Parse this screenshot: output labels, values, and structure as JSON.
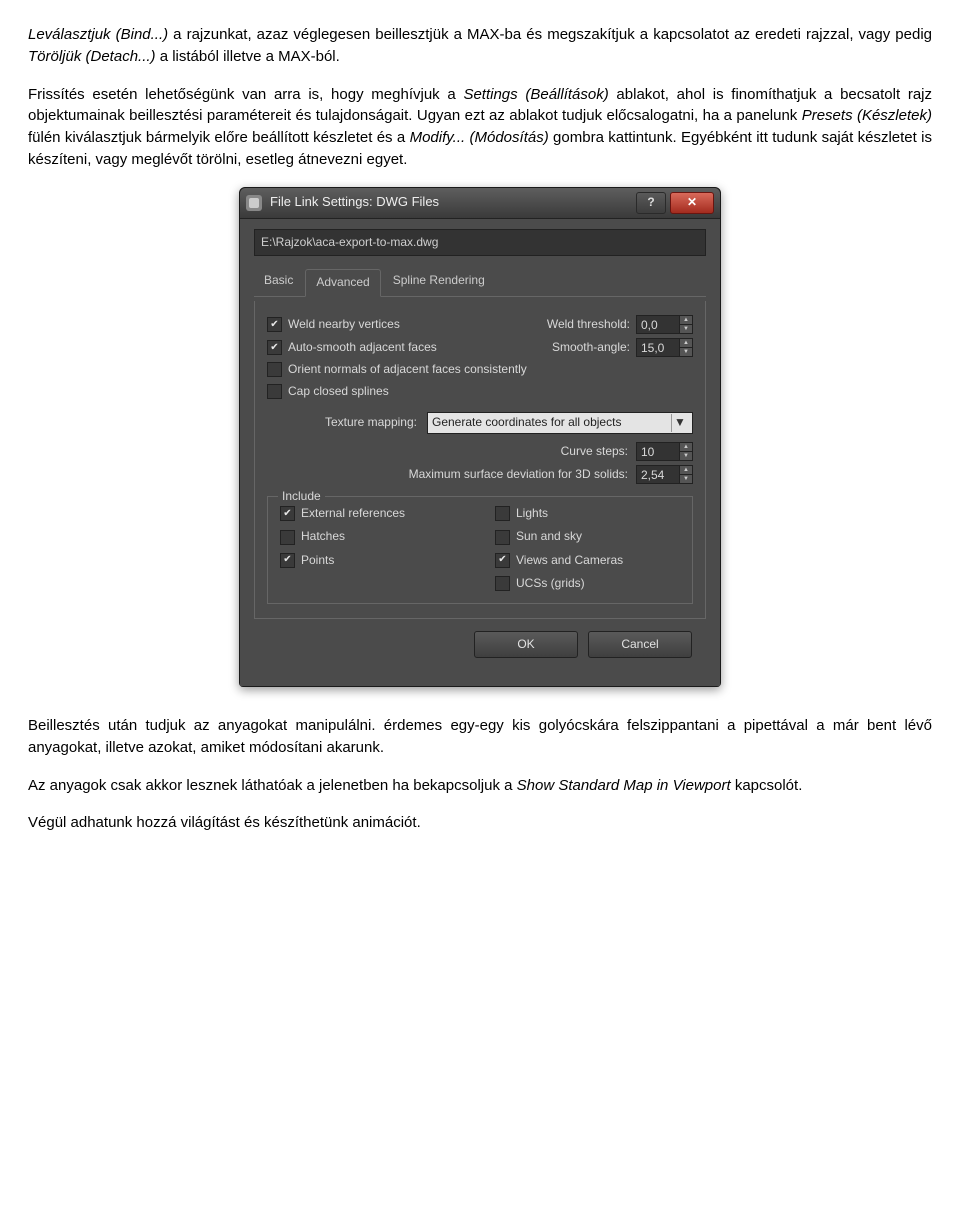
{
  "para1_a": "Leválasztjuk (Bind...)",
  "para1_b": " a rajzunkat, azaz véglegesen beillesztjük a MAX-ba és megszakítjuk a kapcsolatot az eredeti rajzzal, vagy pedig ",
  "para1_c": "Töröljük (Detach...)",
  "para1_d": " a listából illetve a MAX-ból.",
  "para2_a": "Frissítés esetén lehetőségünk van arra is, hogy meghívjuk a ",
  "para2_b": "Settings (Beállítások)",
  "para2_c": " ablakot, ahol is finomíthatjuk a becsatolt rajz objektumainak beillesztési paramétereit és tulajdonságait. Ugyan ezt az ablakot tudjuk előcsalogatni, ha a panelunk ",
  "para2_d": "Presets (Készletek)",
  "para2_e": " fülén kiválasztjuk bármelyik előre beállított készletet és a ",
  "para2_f": "Modify... (Módosítás)",
  "para2_g": " gombra kattintunk. Egyébként itt tudunk saját készletet is készíteni, vagy meglévőt törölni, esetleg átnevezni egyet.",
  "para3": "Beillesztés után tudjuk az anyagokat manipulálni. érdemes egy-egy kis golyócskára felszippantani a pipettával a már bent lévő anyagokat, illetve azokat, amiket módosítani akarunk.",
  "para4_a": "Az anyagok csak akkor lesznek láthatóak a jelenetben ha bekapcsoljuk a ",
  "para4_b": "Show Standard Map in Viewport",
  "para4_c": " kapcsolót.",
  "para5": "Végül adhatunk hozzá világítást és készíthetünk animációt.",
  "dialog": {
    "title": "File Link Settings: DWG Files",
    "path": "E:\\Rajzok\\aca-export-to-max.dwg",
    "tabs": {
      "basic": "Basic",
      "advanced": "Advanced",
      "spline": "Spline Rendering"
    },
    "weld_label": "Weld nearby vertices",
    "weld_thresh_label": "Weld threshold:",
    "weld_thresh_value": "0,0",
    "autosmooth_label": "Auto-smooth adjacent faces",
    "smooth_angle_label": "Smooth-angle:",
    "smooth_angle_value": "15,0",
    "orient_label": "Orient normals of adjacent faces consistently",
    "cap_label": "Cap closed splines",
    "texmap_label": "Texture mapping:",
    "texmap_value": "Generate coordinates for all objects",
    "curve_label": "Curve steps:",
    "curve_value": "10",
    "deviation_label": "Maximum surface deviation for 3D solids:",
    "deviation_value": "2,54",
    "include_label": "Include",
    "inc_ext": "External references",
    "inc_lights": "Lights",
    "inc_hatches": "Hatches",
    "inc_sun": "Sun and sky",
    "inc_points": "Points",
    "inc_views": "Views and Cameras",
    "inc_ucs": "UCSs (grids)",
    "ok": "OK",
    "cancel": "Cancel"
  }
}
